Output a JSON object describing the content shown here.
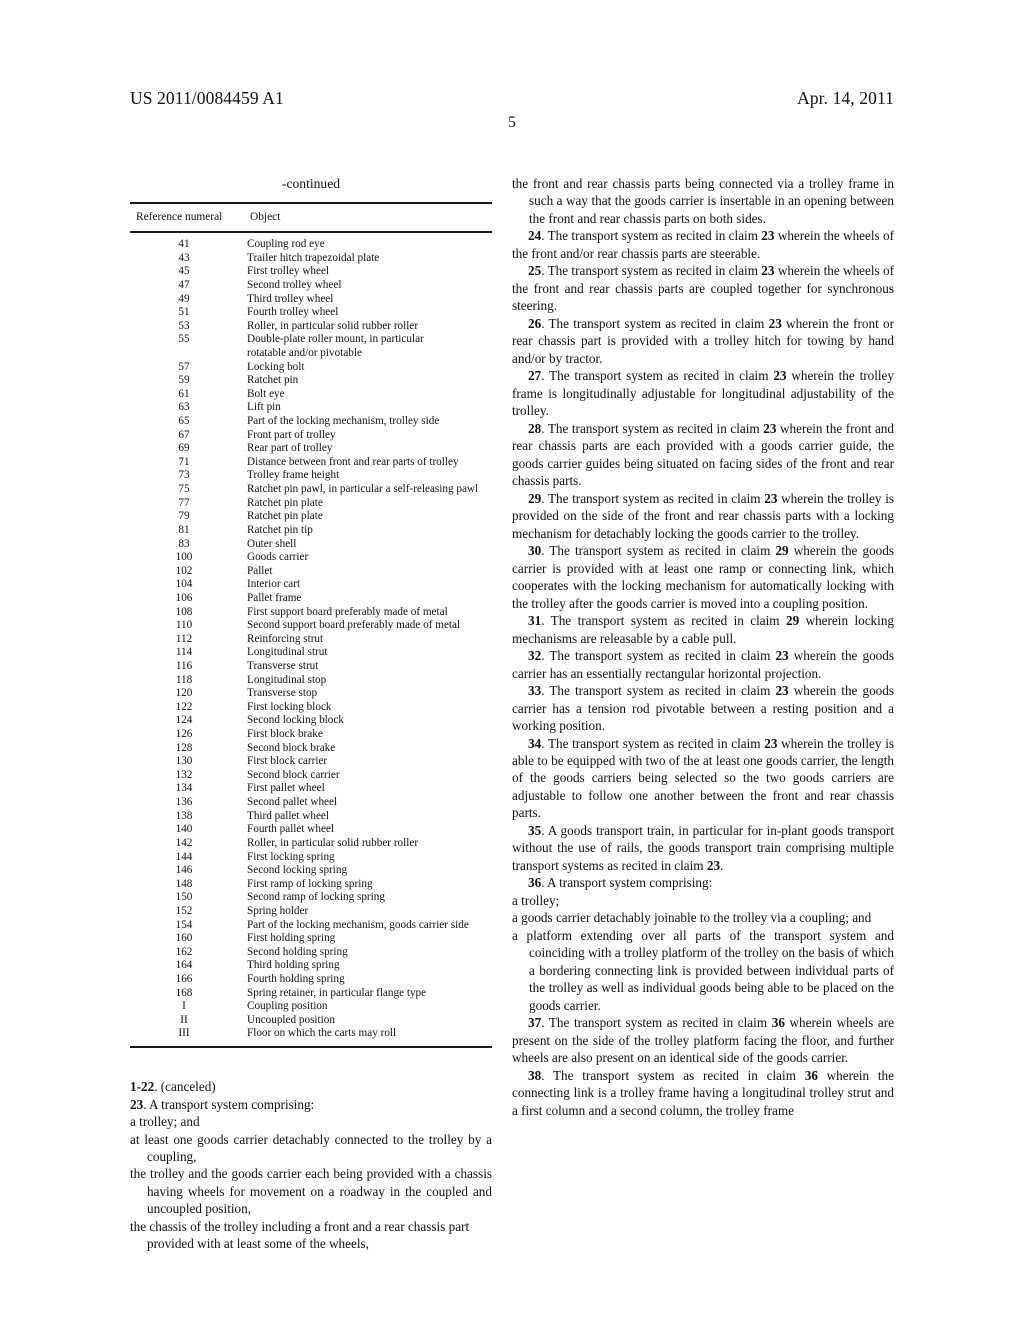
{
  "header": {
    "publication_number": "US 2011/0084459 A1",
    "publication_date": "Apr. 14, 2011",
    "page_number": "5"
  },
  "table": {
    "caption": "-continued",
    "columns": [
      "Reference numeral",
      "Object"
    ],
    "rows": [
      {
        "numeral": "41",
        "object": "Coupling rod eye"
      },
      {
        "numeral": "43",
        "object": "Trailer hitch trapezoidal plate"
      },
      {
        "numeral": "45",
        "object": "First trolley wheel"
      },
      {
        "numeral": "47",
        "object": "Second trolley wheel"
      },
      {
        "numeral": "49",
        "object": "Third trolley wheel"
      },
      {
        "numeral": "51",
        "object": "Fourth trolley wheel"
      },
      {
        "numeral": "53",
        "object": "Roller, in particular solid rubber roller"
      },
      {
        "numeral": "55",
        "object": "Double-plate roller mount, in particular",
        "object_cont": "rotatable and/or pivotable"
      },
      {
        "numeral": "57",
        "object": "Locking bolt"
      },
      {
        "numeral": "59",
        "object": "Ratchet pin"
      },
      {
        "numeral": "61",
        "object": "Bolt eye"
      },
      {
        "numeral": "63",
        "object": "Lift pin"
      },
      {
        "numeral": "65",
        "object": "Part of the locking mechanism, trolley side"
      },
      {
        "numeral": "67",
        "object": "Front part of trolley"
      },
      {
        "numeral": "69",
        "object": "Rear part of trolley"
      },
      {
        "numeral": "71",
        "object": "Distance between front and rear parts of trolley"
      },
      {
        "numeral": "73",
        "object": "Trolley frame height"
      },
      {
        "numeral": "75",
        "object": "Ratchet pin pawl, in particular a self-releasing pawl"
      },
      {
        "numeral": "77",
        "object": "Ratchet pin plate"
      },
      {
        "numeral": "79",
        "object": "Ratchet pin plate"
      },
      {
        "numeral": "81",
        "object": "Ratchet pin tip"
      },
      {
        "numeral": "83",
        "object": "Outer shell"
      },
      {
        "numeral": "100",
        "object": "Goods carrier"
      },
      {
        "numeral": "102",
        "object": "Pallet"
      },
      {
        "numeral": "104",
        "object": "Interior cart"
      },
      {
        "numeral": "106",
        "object": "Pallet frame"
      },
      {
        "numeral": "108",
        "object": "First support board preferably made of metal"
      },
      {
        "numeral": "110",
        "object": "Second support board preferably made of metal"
      },
      {
        "numeral": "112",
        "object": "Reinforcing strut"
      },
      {
        "numeral": "114",
        "object": "Longitudinal strut"
      },
      {
        "numeral": "116",
        "object": "Transverse strut"
      },
      {
        "numeral": "118",
        "object": "Longitudinal stop"
      },
      {
        "numeral": "120",
        "object": "Transverse stop"
      },
      {
        "numeral": "122",
        "object": "First locking block"
      },
      {
        "numeral": "124",
        "object": "Second locking block"
      },
      {
        "numeral": "126",
        "object": "First block brake"
      },
      {
        "numeral": "128",
        "object": "Second block brake"
      },
      {
        "numeral": "130",
        "object": "First block carrier"
      },
      {
        "numeral": "132",
        "object": "Second block carrier"
      },
      {
        "numeral": "134",
        "object": "First pallet wheel"
      },
      {
        "numeral": "136",
        "object": "Second pallet wheel"
      },
      {
        "numeral": "138",
        "object": "Third pallet wheel"
      },
      {
        "numeral": "140",
        "object": "Fourth pallet wheel"
      },
      {
        "numeral": "142",
        "object": "Roller, in particular solid rubber roller"
      },
      {
        "numeral": "144",
        "object": "First locking spring"
      },
      {
        "numeral": "146",
        "object": "Second locking spring"
      },
      {
        "numeral": "148",
        "object": "First ramp of locking spring"
      },
      {
        "numeral": "150",
        "object": "Second ramp of locking spring"
      },
      {
        "numeral": "152",
        "object": "Spring holder"
      },
      {
        "numeral": "154",
        "object": "Part of the locking mechanism, goods carrier side"
      },
      {
        "numeral": "160",
        "object": "First holding spring"
      },
      {
        "numeral": "162",
        "object": "Second holding spring"
      },
      {
        "numeral": "164",
        "object": "Third holding spring"
      },
      {
        "numeral": "166",
        "object": "Fourth holding spring"
      },
      {
        "numeral": "168",
        "object": "Spring retainer, in particular flange type"
      },
      {
        "numeral": "I",
        "object": "Coupling position"
      },
      {
        "numeral": "II",
        "object": "Uncoupled position"
      },
      {
        "numeral": "III",
        "object": "Floor on which the carts may roll"
      }
    ]
  },
  "claims_left": {
    "canceled_num": "1-22",
    "canceled_text": ". (canceled)",
    "c23_num": "23",
    "c23_text": ". A transport system comprising:",
    "c23_a": "a trolley; and",
    "c23_b": "at least one goods carrier detachably connected to the trolley by a coupling,",
    "c23_c": "the trolley and the goods carrier each being provided with a chassis having wheels for movement on a roadway in the coupled and uncoupled position,",
    "c23_d": "the chassis of the trolley including a front and a rear chassis part provided with at least some of the wheels,"
  },
  "claims_right": {
    "c23_e": "the front and rear chassis parts being connected via a trolley frame in such a way that the goods carrier is insertable in an opening between the front and rear chassis parts on both sides.",
    "c24_num": "24",
    "c24_pre": ". The transport system as recited in claim ",
    "c24_ref": "23",
    "c24_post": " wherein the wheels of the front and/or rear chassis parts are steerable.",
    "c25_num": "25",
    "c25_pre": ". The transport system as recited in claim ",
    "c25_ref": "23",
    "c25_post": " wherein the wheels of the front and rear chassis parts are coupled together for synchronous steering.",
    "c26_num": "26",
    "c26_pre": ". The transport system as recited in claim ",
    "c26_ref": "23",
    "c26_post": " wherein the front or rear chassis part is provided with a trolley hitch for towing by hand and/or by tractor.",
    "c27_num": "27",
    "c27_pre": ". The transport system as recited in claim ",
    "c27_ref": "23",
    "c27_post": " wherein the trolley frame is longitudinally adjustable for longitudinal adjustability of the trolley.",
    "c28_num": "28",
    "c28_pre": ". The transport system as recited in claim ",
    "c28_ref": "23",
    "c28_post": " wherein the front and rear chassis parts are each provided with a goods carrier guide, the goods carrier guides being situated on facing sides of the front and rear chassis parts.",
    "c29_num": "29",
    "c29_pre": ". The transport system as recited in claim ",
    "c29_ref": "23",
    "c29_post": " wherein the trolley is provided on the side of the front and rear chassis parts with a locking mechanism for detachably locking the goods carrier to the trolley.",
    "c30_num": "30",
    "c30_pre": ". The transport system as recited in claim ",
    "c30_ref": "29",
    "c30_post": " wherein the goods carrier is provided with at least one ramp or connecting link, which cooperates with the locking mechanism for automatically locking with the trolley after the goods carrier is moved into a coupling position.",
    "c31_num": "31",
    "c31_pre": ". The transport system as recited in claim ",
    "c31_ref": "29",
    "c31_post": " wherein locking mechanisms are releasable by a cable pull.",
    "c32_num": "32",
    "c32_pre": ". The transport system as recited in claim ",
    "c32_ref": "23",
    "c32_post": " wherein the goods carrier has an essentially rectangular horizontal projection.",
    "c33_num": "33",
    "c33_pre": ". The transport system as recited in claim ",
    "c33_ref": "23",
    "c33_post": " wherein the goods carrier has a tension rod pivotable between a resting position and a working position.",
    "c34_num": "34",
    "c34_pre": ". The transport system as recited in claim ",
    "c34_ref": "23",
    "c34_post": " wherein the trolley is able to be equipped with two of the at least one goods carrier, the length of the goods carriers being selected so the two goods carriers are adjustable to follow one another between the front and rear chassis parts.",
    "c35_num": "35",
    "c35_pre": ". A goods transport train, in particular for in-plant goods transport without the use of rails, the goods transport train comprising multiple transport systems as recited in claim ",
    "c35_ref": "23",
    "c35_post": ".",
    "c36_num": "36",
    "c36_text": ". A transport system comprising:",
    "c36_a": "a trolley;",
    "c36_b": "a goods carrier detachably joinable to the trolley via a coupling; and",
    "c36_c": "a platform extending over all parts of the transport system and coinciding with a trolley platform of the trolley on the basis of which a bordering connecting link is provided between individual parts of the trolley as well as individual goods being able to be placed on the goods carrier.",
    "c37_num": "37",
    "c37_pre": ". The transport system as recited in claim ",
    "c37_ref": "36",
    "c37_post": " wherein wheels are present on the side of the trolley platform facing the floor, and further wheels are also present on an identical side of the goods carrier.",
    "c38_num": "38",
    "c38_pre": ". The transport system as recited in claim ",
    "c38_ref": "36",
    "c38_post": " wherein the connecting link is a trolley frame having a longitudinal trolley strut and a first column and a second column, the trolley frame"
  }
}
